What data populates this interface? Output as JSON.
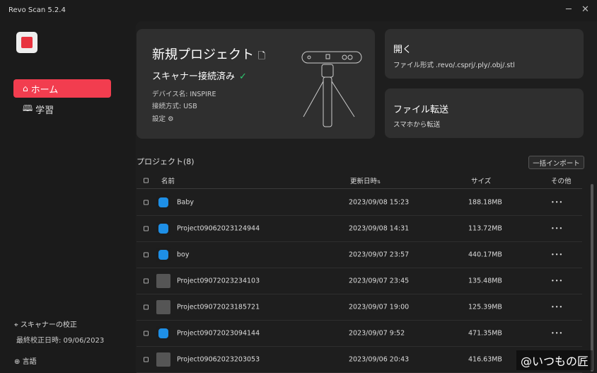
{
  "window": {
    "title": "Revo Scan 5.2.4",
    "minimize": "─",
    "close": "✕"
  },
  "sidebar": {
    "items": [
      {
        "label": "ホーム",
        "icon": "home-icon",
        "glyph": "⌂",
        "active": true
      },
      {
        "label": "学習",
        "icon": "book-icon",
        "glyph": "🕮",
        "active": false
      }
    ],
    "calibration": {
      "label": "スキャナーの校正",
      "icon": "crosshair-icon",
      "glyph": "⌖",
      "last_label": "最終校正日時: 09/06/2023"
    },
    "language": {
      "label": "言語",
      "icon": "globe-icon",
      "glyph": "⊕"
    }
  },
  "new_project": {
    "title": "新規プロジェクト",
    "status": "スキャナー接続済み",
    "check": "✓",
    "device": "デバイス名: INSPIRE",
    "connection": "接続方式: USB",
    "settings": "設定",
    "settings_glyph": "⚙"
  },
  "open": {
    "title": "開く",
    "subtitle": "ファイル形式 .revo/.csprj/.ply/.obj/.stl"
  },
  "transfer": {
    "title": "ファイル転送",
    "subtitle": "スマホから転送"
  },
  "projects": {
    "title": "プロジェクト(8)",
    "import_button": "一括インポート",
    "columns": {
      "name": "名前",
      "updated": "更新日時",
      "sort": "⇅",
      "size": "サイズ",
      "other": "その他"
    },
    "rows": [
      {
        "name": "Baby",
        "updated": "2023/09/08 15:23",
        "size": "188.18MB",
        "thumb": "blue",
        "more": "•••"
      },
      {
        "name": "Project09062023124944",
        "updated": "2023/09/08 14:31",
        "size": "113.72MB",
        "thumb": "blue",
        "more": "•••"
      },
      {
        "name": "boy",
        "updated": "2023/09/07 23:57",
        "size": "440.17MB",
        "thumb": "blue",
        "more": "•••"
      },
      {
        "name": "Project09072023234103",
        "updated": "2023/09/07 23:45",
        "size": "135.48MB",
        "thumb": "gray",
        "more": "•••"
      },
      {
        "name": "Project09072023185721",
        "updated": "2023/09/07 19:00",
        "size": "125.39MB",
        "thumb": "gray",
        "more": "•••"
      },
      {
        "name": "Project09072023094144",
        "updated": "2023/09/07 9:52",
        "size": "471.35MB",
        "thumb": "blue",
        "more": "•••"
      },
      {
        "name": "Project09062023203053",
        "updated": "2023/09/06 20:43",
        "size": "416.63MB",
        "thumb": "gray",
        "more": "•••"
      }
    ]
  },
  "watermark": "@いつもの匠",
  "colors": {
    "accent": "#f23d4f",
    "connected": "#2ecc71",
    "thumb_blue": "#1e8fe6"
  }
}
